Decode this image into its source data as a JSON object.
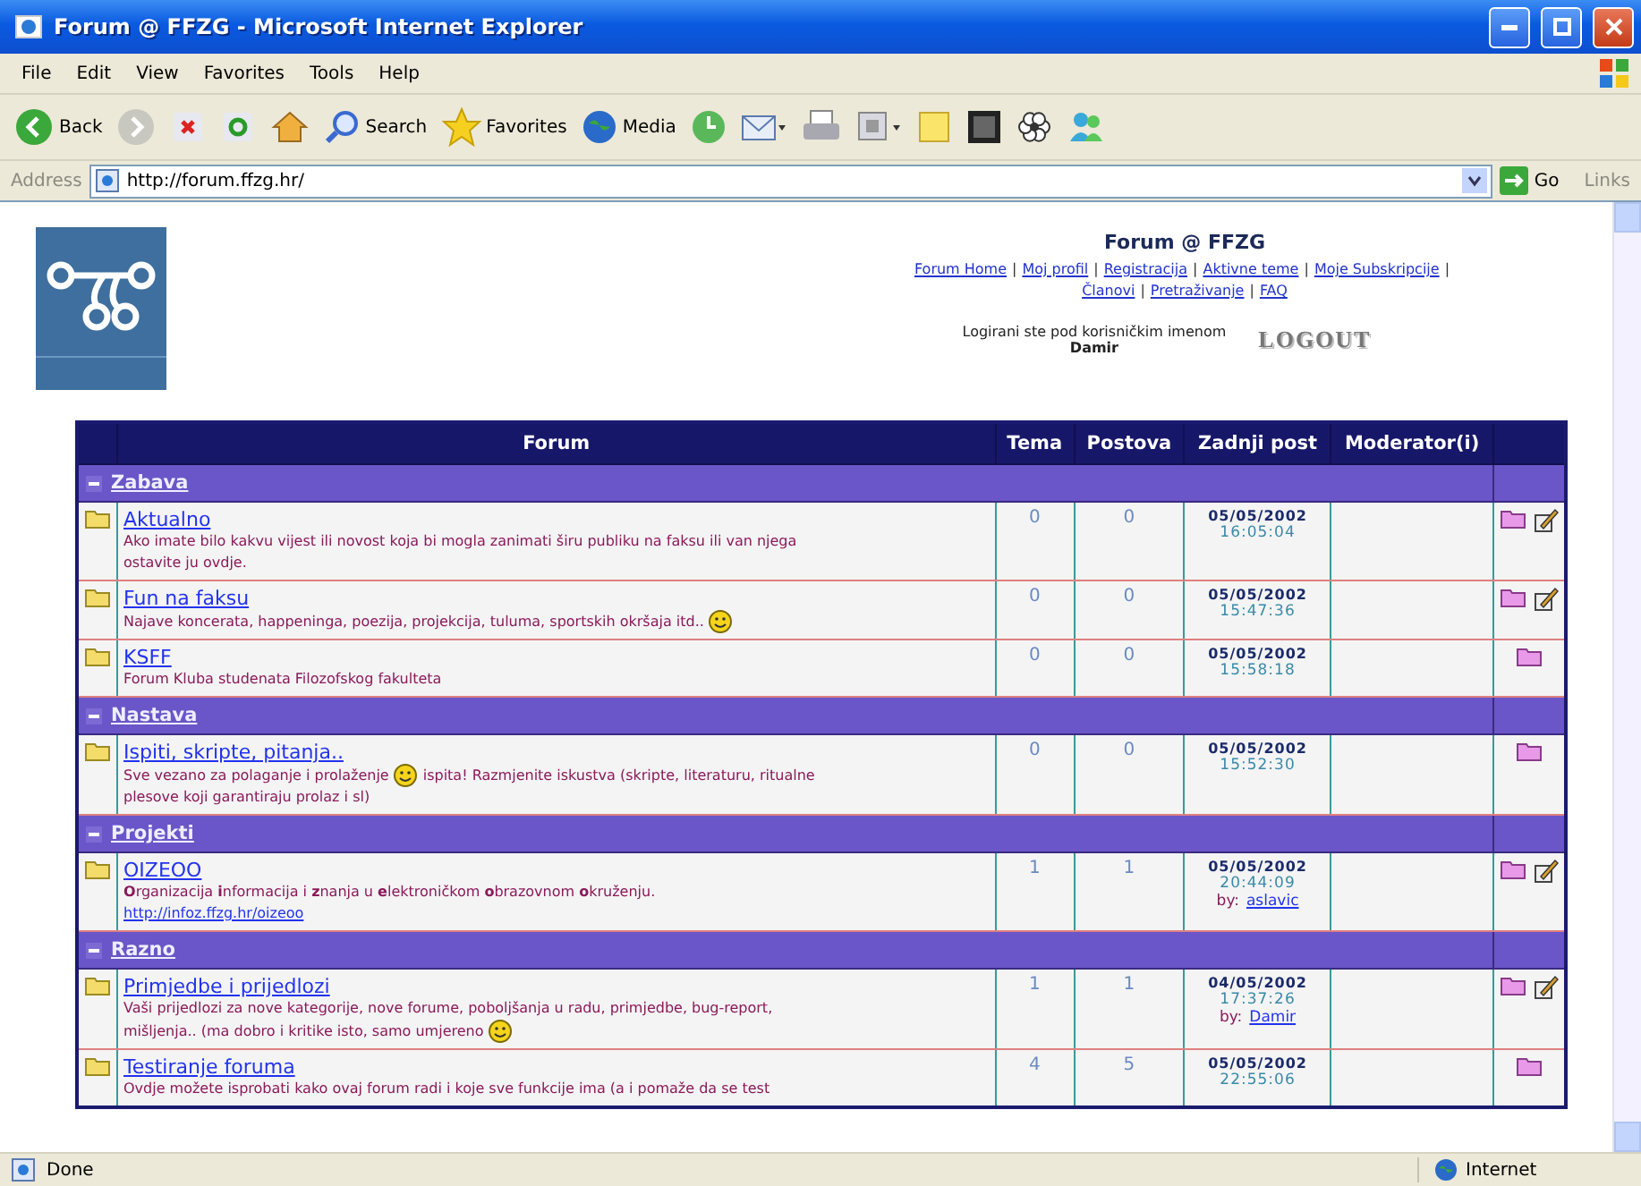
{
  "window": {
    "title": "Forum @ FFZG - Microsoft Internet Explorer"
  },
  "menu": [
    "File",
    "Edit",
    "View",
    "Favorites",
    "Tools",
    "Help"
  ],
  "toolbar": [
    {
      "kind": "back",
      "label": "Back"
    },
    {
      "kind": "forward"
    },
    {
      "kind": "stop"
    },
    {
      "kind": "refresh"
    },
    {
      "kind": "home"
    },
    {
      "kind": "search",
      "label": "Search"
    },
    {
      "kind": "favorites",
      "label": "Favorites"
    },
    {
      "kind": "media",
      "label": "Media"
    },
    {
      "kind": "history"
    },
    {
      "kind": "mail"
    },
    {
      "kind": "print"
    },
    {
      "kind": "edit"
    },
    {
      "kind": "note"
    },
    {
      "kind": "vr"
    },
    {
      "kind": "flower"
    },
    {
      "kind": "messenger"
    }
  ],
  "address": {
    "label": "Address",
    "value": "http://forum.ffzg.hr/",
    "go": "Go",
    "links": "Links"
  },
  "header": {
    "title": "Forum @ FFZG",
    "nav": [
      "Forum Home",
      "Moj profil",
      "Registracija",
      "Aktivne teme",
      "Moje Subskripcije",
      "Članovi",
      "Pretraživanje",
      "FAQ"
    ],
    "separator": "|",
    "login_text": "Logirani ste pod korisničkim imenom",
    "user": "Damir",
    "logout": "LOGOUT"
  },
  "table": {
    "columns": [
      "Forum",
      "Tema",
      "Postova",
      "Zadnji post",
      "Moderator(i)"
    ],
    "categories": [
      {
        "name": "Zabava",
        "forums": [
          {
            "name": "Aktualno",
            "description": [
              [
                {
                  "text": "Ako imate bilo kakvu vijest ili novost koja bi mogla zanimati širu publiku na faksu ili van njega"
                }
              ],
              [
                {
                  "text": "ostavite ju ovdje."
                }
              ]
            ],
            "topics": "0",
            "posts": "0",
            "last_date": "05/05/2002",
            "last_time": "16:05:04",
            "editable": true
          },
          {
            "name": "Fun na faksu",
            "description": [
              [
                {
                  "text": "Najave koncerata, happeninga, poezija, projekcija, tuluma, sportskih okršaja itd.."
                },
                {
                  "kind": "smiley"
                }
              ]
            ],
            "topics": "0",
            "posts": "0",
            "last_date": "05/05/2002",
            "last_time": "15:47:36",
            "editable": true
          },
          {
            "name": "KSFF",
            "description": [
              [
                {
                  "text": "Forum Kluba studenata Filozofskog fakulteta"
                }
              ]
            ],
            "topics": "0",
            "posts": "0",
            "last_date": "05/05/2002",
            "last_time": "15:58:18",
            "editable": false
          }
        ]
      },
      {
        "name": "Nastava",
        "forums": [
          {
            "name": "Ispiti, skripte, pitanja..",
            "description": [
              [
                {
                  "text": "Sve vezano za polaganje i prolaženje"
                },
                {
                  "kind": "smiley"
                },
                {
                  "text": "ispita! Razmjenite iskustva (skripte, literaturu, ritualne"
                }
              ],
              [
                {
                  "text": "plesove koji garantiraju prolaz i sl)"
                }
              ]
            ],
            "topics": "0",
            "posts": "0",
            "last_date": "05/05/2002",
            "last_time": "15:52:30",
            "editable": false
          }
        ]
      },
      {
        "name": "Projekti",
        "forums": [
          {
            "name": "OIZEOO",
            "description": [
              [
                {
                  "text": "**O**rganizacija **i**nformacija i **z**nanja u **e**lektroničkom **o**brazovnom **o**kruženju."
                }
              ],
              [
                {
                  "kind": "link",
                  "text": "http://infoz.ffzg.hr/oizeoo"
                }
              ]
            ],
            "topics": "1",
            "posts": "1",
            "last_date": "05/05/2002",
            "last_time": "20:44:09",
            "by_label": "by:",
            "by_user": "aslavic",
            "editable": true
          }
        ]
      },
      {
        "name": "Razno",
        "forums": [
          {
            "name": "Primjedbe i prijedlozi",
            "description": [
              [
                {
                  "text": "Vaši prijedlozi za nove kategorije, nove forume, poboljšanja u radu, primjedbe, bug-report,"
                }
              ],
              [
                {
                  "text": "mišljenja.. (ma dobro i kritike isto, samo umjereno"
                },
                {
                  "kind": "smiley"
                }
              ]
            ],
            "topics": "1",
            "posts": "1",
            "last_date": "04/05/2002",
            "last_time": "17:37:26",
            "by_label": "by:",
            "by_user": "Damir",
            "editable": true
          },
          {
            "name": "Testiranje foruma",
            "description": [
              [
                {
                  "text": "Ovdje možete isprobati kako ovaj forum radi i koje sve funkcije ima (a i pomaže da se test"
                }
              ]
            ],
            "topics": "4",
            "posts": "5",
            "last_date": "05/05/2002",
            "last_time": "22:55:06",
            "editable": false
          }
        ]
      }
    ]
  },
  "status_bar": {
    "text": "Done",
    "zone": "Internet"
  }
}
